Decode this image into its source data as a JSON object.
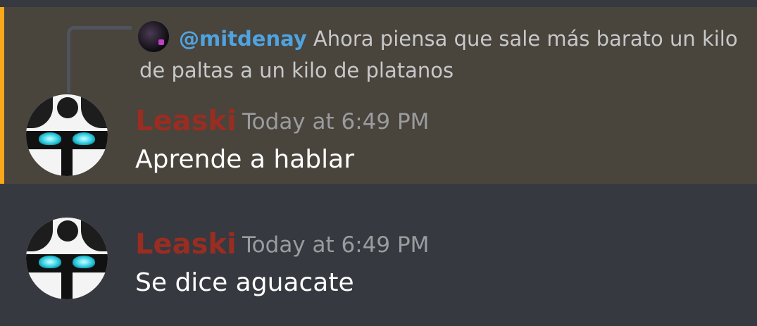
{
  "messages": [
    {
      "reply": {
        "mention": "@mitdenay",
        "text": "Ahora piensa que sale más barato un kilo de paltas a un kilo de platanos"
      },
      "author": "Leaski",
      "timestamp": "Today at 6:49 PM",
      "content": "Aprende a hablar",
      "highlighted": true
    },
    {
      "author": "Leaski",
      "timestamp": "Today at 6:49 PM",
      "content": "Se dice aguacate",
      "highlighted": false
    }
  ],
  "colors": {
    "background": "#36393f",
    "highlight_background": "#49443c",
    "highlight_border": "#faa81a",
    "username": "#992d22",
    "mention": "#4fa3e0",
    "timestamp": "#9a9c9f"
  }
}
